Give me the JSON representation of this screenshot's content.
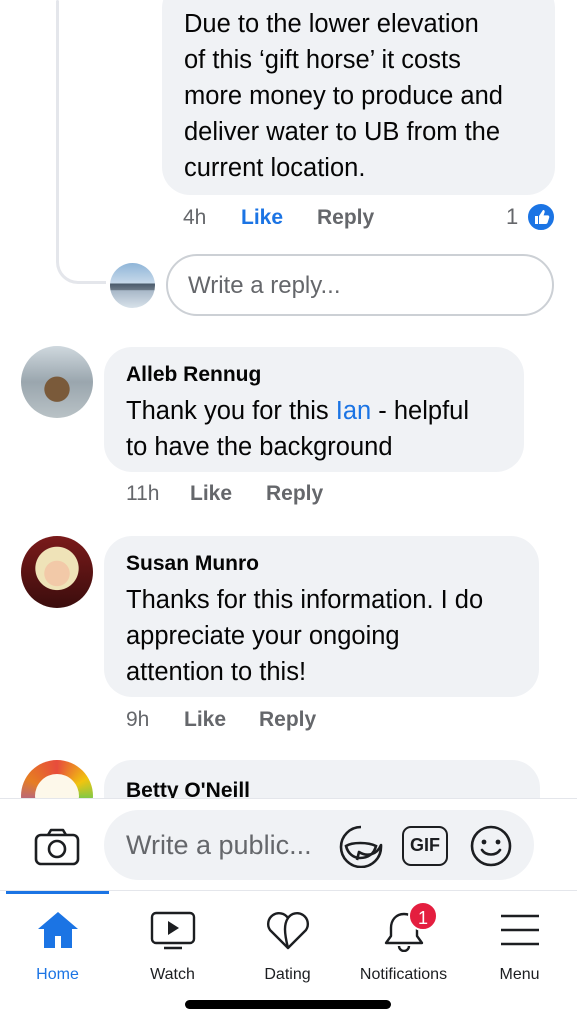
{
  "top_reply": {
    "lines": [
      "Due to the lower elevation",
      "of this ‘gift horse’ it costs",
      "more money to produce and",
      "deliver water to UB from the",
      "current location."
    ],
    "time": "4h",
    "like_label": "Like",
    "reply_label": "Reply",
    "like_count": "1"
  },
  "reply_input": {
    "placeholder": "Write a reply..."
  },
  "comments": [
    {
      "name": "Alleb Rennug",
      "text_before": "Thank you for this ",
      "mention": "Ian",
      "text_after": " - helpful",
      "line2": "to have the background",
      "time": "11h",
      "like_label": "Like",
      "reply_label": "Reply"
    },
    {
      "name": "Susan Munro",
      "lines": [
        "Thanks for this information. I do",
        "appreciate your ongoing",
        "attention to this!"
      ],
      "time": "9h",
      "like_label": "Like",
      "reply_label": "Reply"
    },
    {
      "name": "Betty O'Neill"
    }
  ],
  "composer": {
    "placeholder": "Write a public...",
    "gif_label": "GIF"
  },
  "tabs": [
    {
      "label": "Home",
      "icon": "home-icon",
      "active": true
    },
    {
      "label": "Watch",
      "icon": "watch-icon"
    },
    {
      "label": "Dating",
      "icon": "dating-icon"
    },
    {
      "label": "Notifications",
      "icon": "bell-icon",
      "badge": "1"
    },
    {
      "label": "Menu",
      "icon": "menu-icon"
    }
  ],
  "colors": {
    "accent": "#1b74e4",
    "badge": "#e41e3f",
    "bubble": "#f0f2f5"
  }
}
